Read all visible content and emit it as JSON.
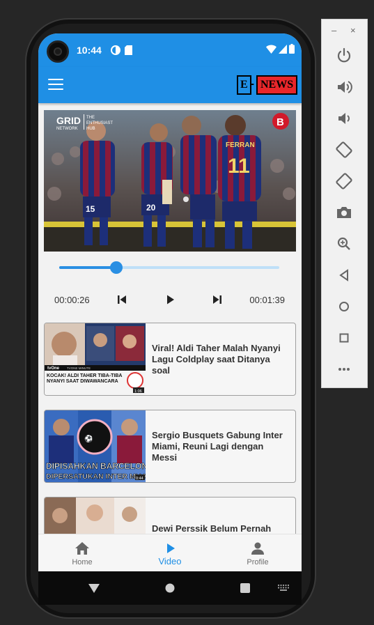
{
  "status": {
    "time": "10:44"
  },
  "appbar": {
    "logo_e": "E",
    "logo_dash": "-",
    "logo_news": "NEWS"
  },
  "player": {
    "current_time": "00:00:26",
    "total_time": "00:01:39",
    "progress": 0.26
  },
  "news": [
    {
      "title": "Viral! Aldi Taher Malah Nyanyi Lagu Coldplay saat Ditanya soal",
      "thumb_caption": "KOCAK! ALDI TAHER TIBA-TIBA NYANYI SAAT DIWAWANCARA",
      "thumb_channel": "tvOne",
      "thumb_channel_sub": "TVONE MINUTE",
      "thumb_duration": "1:06"
    },
    {
      "title": "Sergio Busquets Gabung Inter Miami, Reuni Lagi dengan Messi",
      "thumb_caption_1": "DIPISAHKAN BARCELONA",
      "thumb_caption_2": "DIPERSATUKAN INTER MIAMI",
      "thumb_duration": "0:44"
    },
    {
      "title": "Dewi Perssik Belum Pernah"
    }
  ],
  "video_watermark": {
    "grid": "GRID",
    "network": "NETWORK",
    "hub_1": "THE",
    "hub_2": "ENTHUSIAST",
    "hub_3": "HUB",
    "badge": "B",
    "jersey_1": "15",
    "jersey_2": "20",
    "jersey_3": "11",
    "jersey_name": "FERRAN"
  },
  "bottom_nav": [
    {
      "label": "Home",
      "icon": "home-icon"
    },
    {
      "label": "Video",
      "icon": "play-icon"
    },
    {
      "label": "Profile",
      "icon": "person-icon"
    }
  ],
  "emulator": {
    "minimize": "–",
    "close": "×"
  },
  "colors": {
    "primary": "#1f8fe5",
    "news_red": "#e8262a",
    "slider": "#2a8fe3"
  }
}
